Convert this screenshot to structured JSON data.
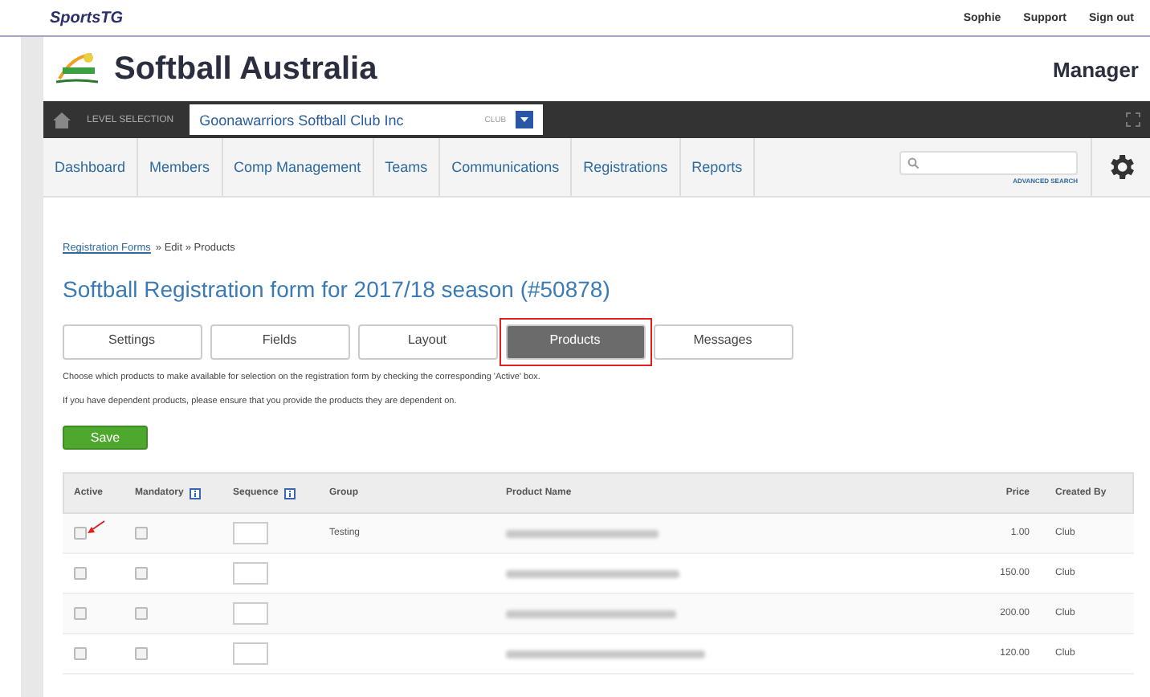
{
  "brand": "SportsTG",
  "user_links": [
    "Sophie",
    "Support",
    "Sign out"
  ],
  "org_title": "Softball Australia",
  "app_name": "Manager",
  "level_bar": {
    "label": "LEVEL SELECTION",
    "value": "Goonawarriors Softball Club Inc",
    "level_tag": "CLUB"
  },
  "nav": [
    {
      "label": "Dashboard"
    },
    {
      "label": "Members"
    },
    {
      "label": "Comp Management"
    },
    {
      "label": "Teams"
    },
    {
      "label": "Communications"
    },
    {
      "label": "Registrations"
    },
    {
      "label": "Reports"
    }
  ],
  "search": {
    "link": "ADVANCED SEARCH"
  },
  "breadcrumb": {
    "link": "Registration Forms",
    "rest": "» Edit » Products"
  },
  "page_title": "Softball Registration form for 2017/18 season (#50878)",
  "tabs": [
    {
      "label": "Settings",
      "selected": false
    },
    {
      "label": "Fields",
      "selected": false
    },
    {
      "label": "Layout",
      "selected": false
    },
    {
      "label": "Products",
      "selected": true
    },
    {
      "label": "Messages",
      "selected": false
    }
  ],
  "instructions": [
    "Choose which products to make available for selection on the registration form by checking the corresponding 'Active' box.",
    "If you have dependent products, please ensure that you provide the products they are dependent on."
  ],
  "save_button": "Save",
  "table": {
    "columns": [
      "Active",
      "Mandatory",
      "Sequence",
      "Group",
      "Product Name",
      "Price",
      "Created By"
    ],
    "rows": [
      {
        "active": false,
        "mandatory": false,
        "group": "Testing",
        "price": "1.00",
        "created_by": "Club"
      },
      {
        "active": false,
        "mandatory": false,
        "price": "150.00",
        "created_by": "Club"
      },
      {
        "active": false,
        "mandatory": false,
        "price": "200.00",
        "created_by": "Club"
      },
      {
        "active": false,
        "mandatory": false,
        "price": "120.00",
        "created_by": "Club"
      }
    ]
  }
}
